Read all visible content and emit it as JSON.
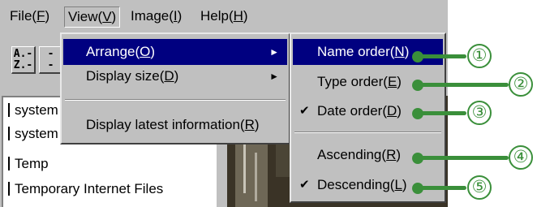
{
  "menubar": {
    "items": [
      {
        "label": "File(",
        "key": "F",
        "end": ")"
      },
      {
        "label": "View(",
        "key": "V",
        "end": ")"
      },
      {
        "label": "Image(",
        "key": "I",
        "end": ")"
      },
      {
        "label": "Help(",
        "key": "H",
        "end": ")"
      }
    ]
  },
  "toolbar": {
    "sort_button_top": "A.-",
    "sort_button_bottom": "Z.-",
    "second_button": "-"
  },
  "folder_list": [
    "system",
    "system",
    "Temp",
    "Temporary Internet Files"
  ],
  "view_menu": {
    "items": [
      {
        "label": "Arrange(",
        "key": "O",
        "end": ")"
      },
      {
        "label": "Display size(",
        "key": "D",
        "end": ")"
      },
      {
        "label": "Display latest information(",
        "key": "R",
        "end": ")"
      }
    ],
    "submenu_arrow": "►"
  },
  "arrange_submenu": {
    "items": [
      {
        "label": "Name order(",
        "key": "N",
        "end": ")"
      },
      {
        "label": "Type order(",
        "key": "E",
        "end": ")"
      },
      {
        "label": "Date order(",
        "key": "D",
        "end": ")",
        "checked": true
      },
      {
        "label": "Ascending(",
        "key": "R",
        "end": ")"
      },
      {
        "label": "Descending(",
        "key": "L",
        "end": ")",
        "checked": true
      }
    ],
    "check_glyph": "✔"
  },
  "callouts": [
    "①",
    "②",
    "③",
    "④",
    "⑤"
  ],
  "colors": {
    "menu_highlight": "#000080",
    "callout_green": "#3a8f3a",
    "window_face": "#c0c0c0"
  }
}
